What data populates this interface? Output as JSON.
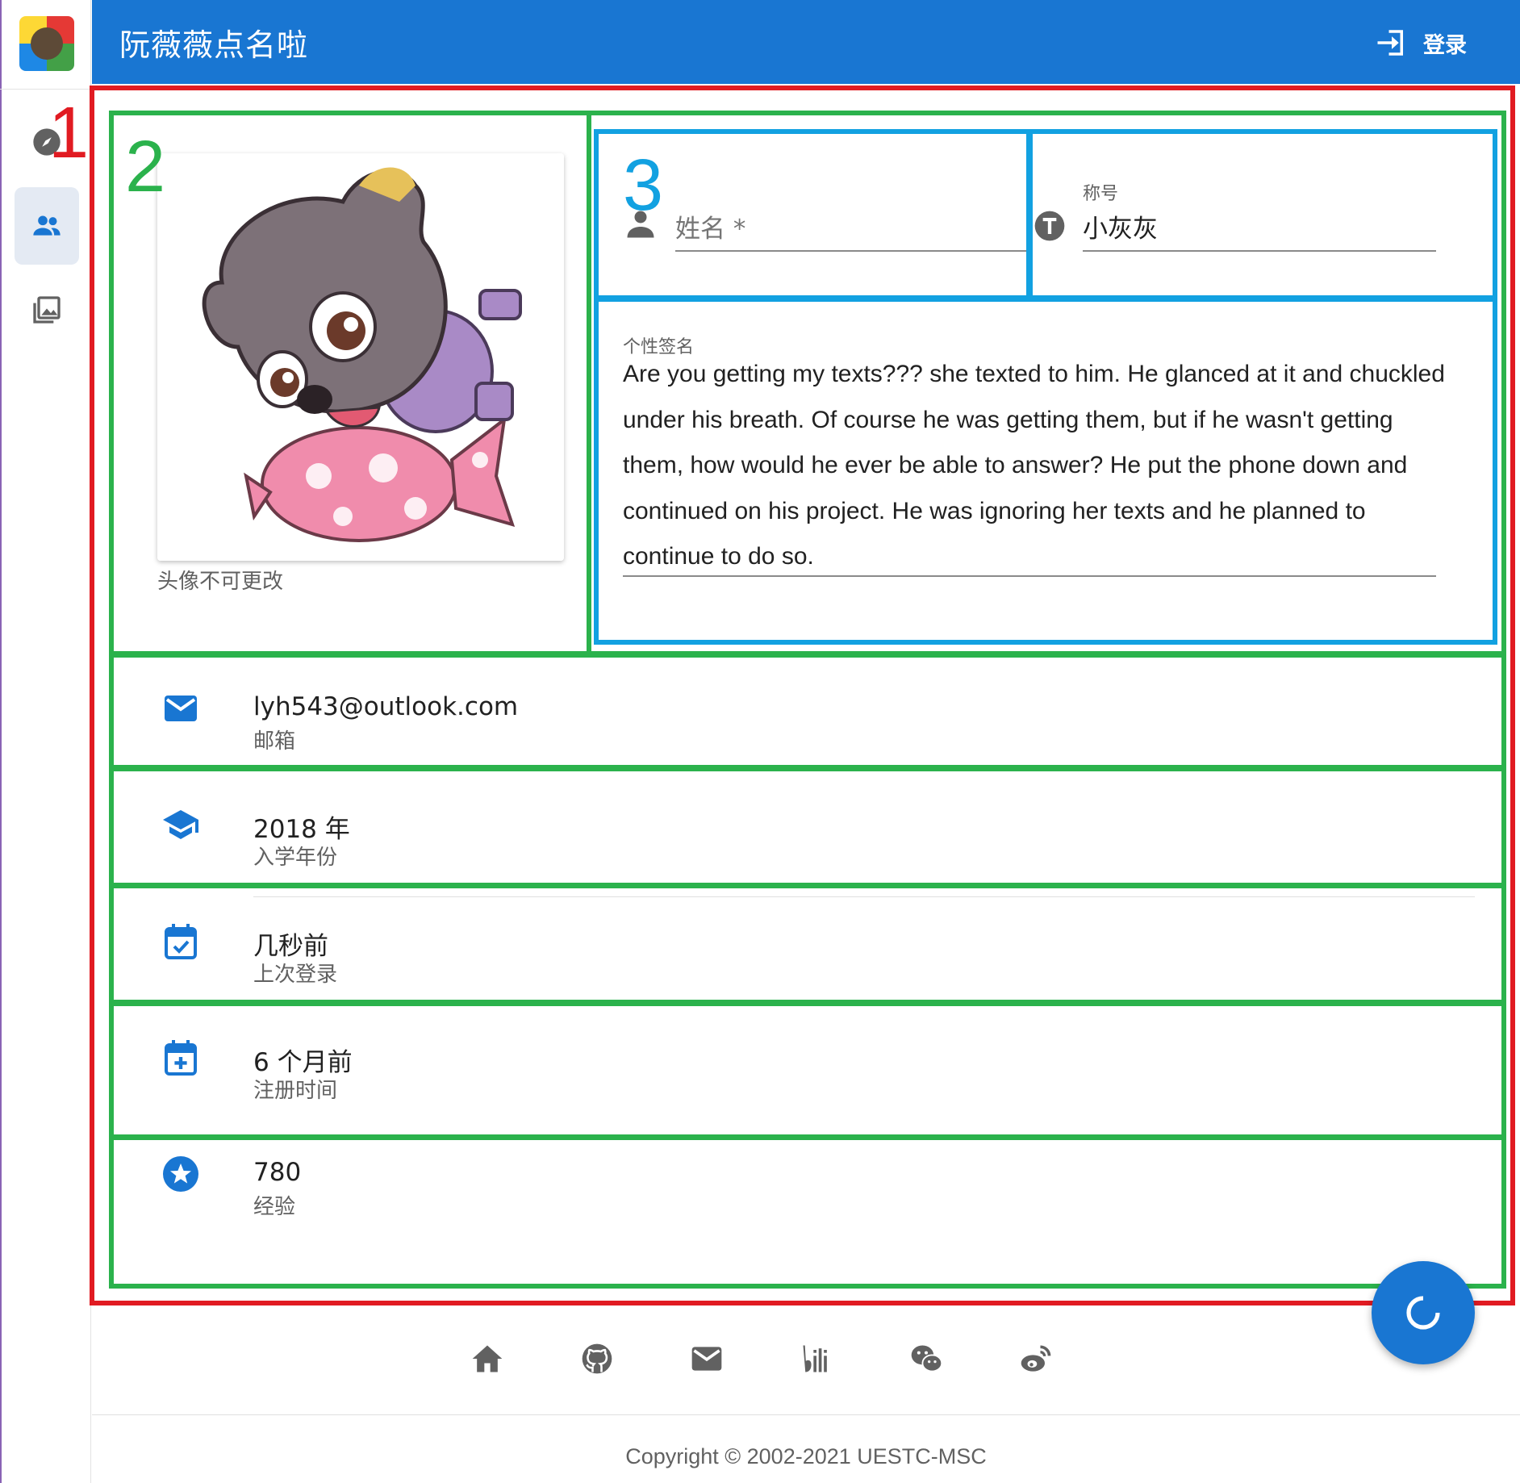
{
  "app": {
    "title": "阮薇薇点名啦",
    "login_label": "登录"
  },
  "nav": {
    "items": [
      {
        "icon": "compass-icon"
      },
      {
        "icon": "people-icon",
        "active": true
      },
      {
        "icon": "gallery-icon"
      }
    ]
  },
  "annotations": {
    "region1": "1",
    "region2": "2",
    "region3": "3"
  },
  "profile": {
    "avatar_note": "头像不可更改",
    "name_label": "姓名 *",
    "name_value": "",
    "title_label": "称号",
    "title_value": "小灰灰",
    "signature_label": "个性签名",
    "signature": "Are you getting my texts??? she texted to him. He glanced at it and chuckled under his breath. Of course he was getting them, but if he wasn't getting them, how would he ever be able to answer? He put the phone down and continued on his project. He was ignoring her texts and he planned to continue to do so."
  },
  "info": {
    "email": {
      "value": "lyh543@outlook.com",
      "label": "邮箱"
    },
    "enrollment": {
      "value": "2018 年",
      "label": "入学年份"
    },
    "last_login": {
      "value": "几秒前",
      "label": "上次登录"
    },
    "registered": {
      "value": "6 个月前",
      "label": "注册时间"
    },
    "experience": {
      "value": "780",
      "label": "经验"
    }
  },
  "footer": {
    "icons": [
      "home-icon",
      "github-icon",
      "mail-icon",
      "bilibili-icon",
      "wechat-icon",
      "weibo-icon"
    ],
    "copyright": "Copyright © 2002-2021 UESTC-MSC"
  },
  "colors": {
    "primary": "#1976d2",
    "annotation_red": "#e11b22",
    "annotation_green": "#2bb24c",
    "annotation_blue": "#12a1e1"
  }
}
